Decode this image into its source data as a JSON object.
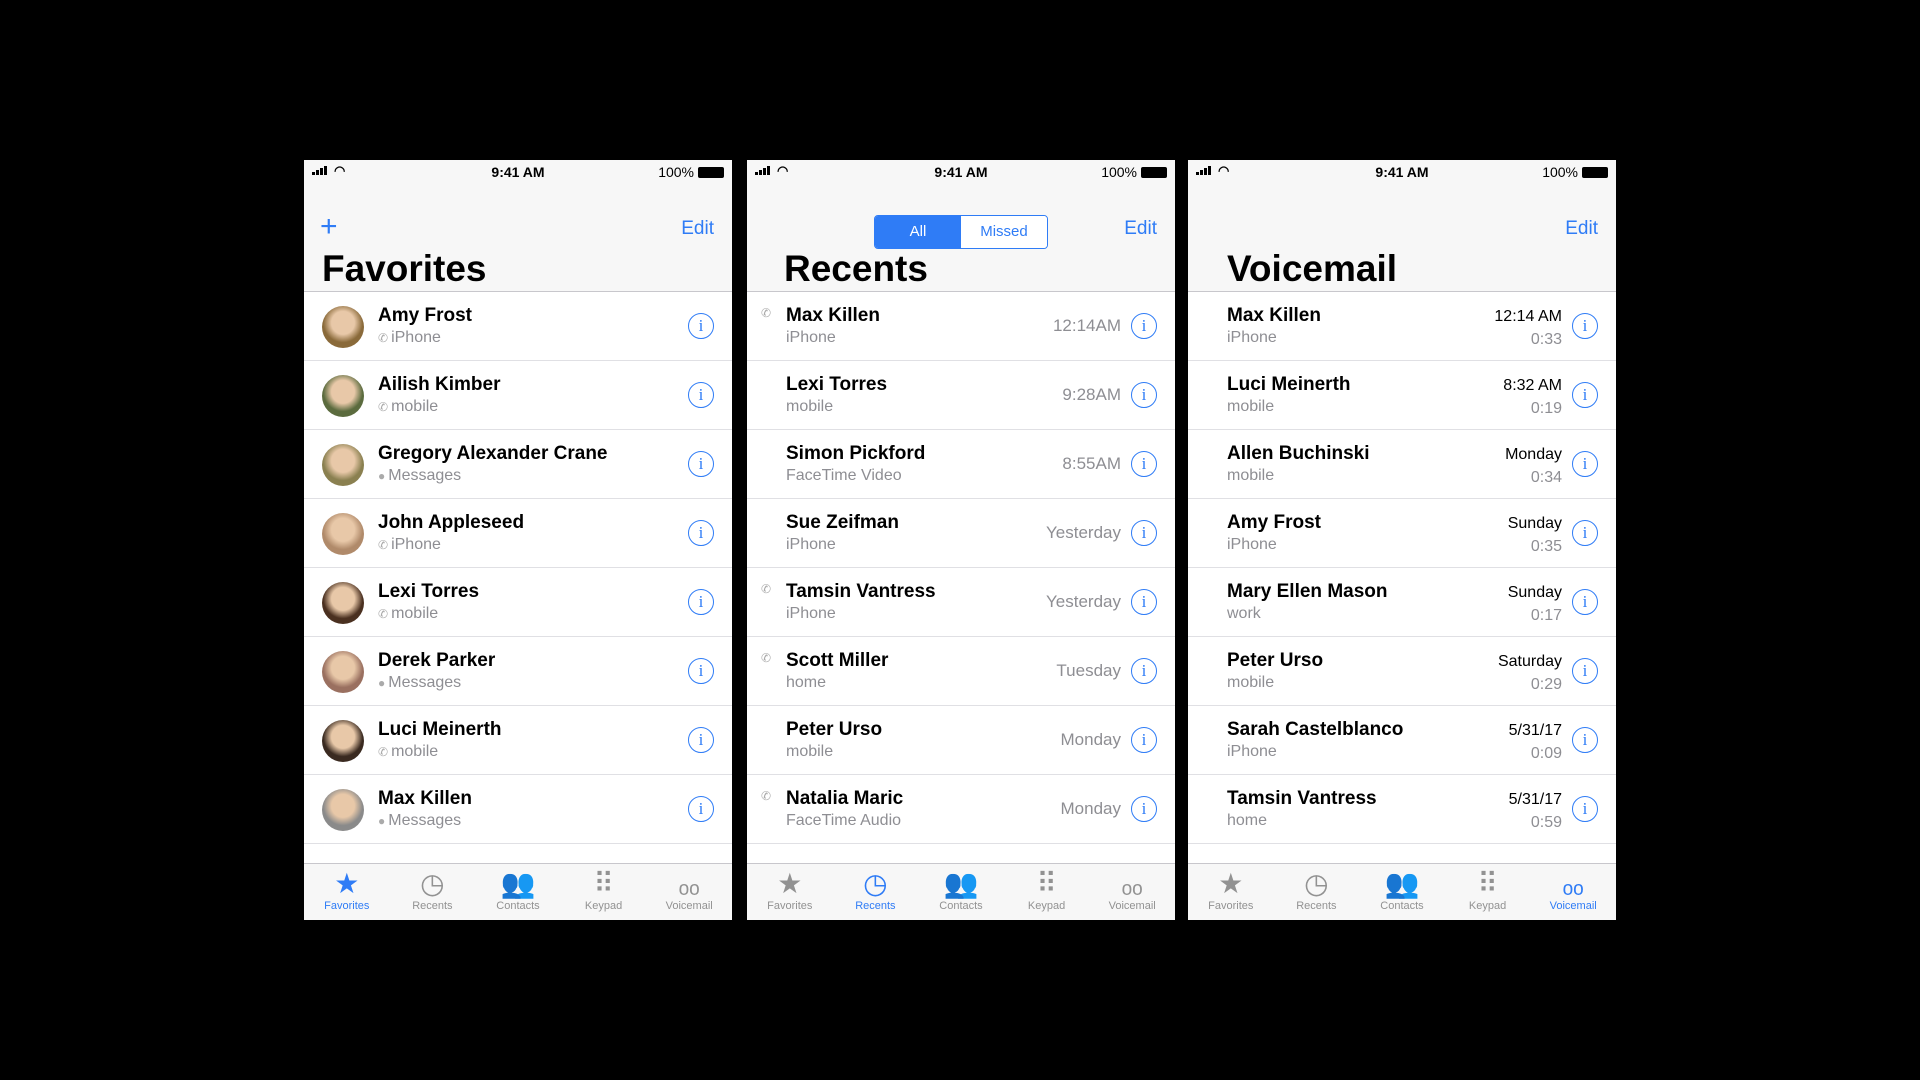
{
  "status": {
    "time": "9:41 AM",
    "battery": "100%"
  },
  "accent": "#2f7cf6",
  "tabbar": [
    {
      "label": "Favorites",
      "icon": "star-icon"
    },
    {
      "label": "Recents",
      "icon": "clock-icon"
    },
    {
      "label": "Contacts",
      "icon": "contacts-icon"
    },
    {
      "label": "Keypad",
      "icon": "keypad-icon"
    },
    {
      "label": "Voicemail",
      "icon": "voicemail-icon"
    }
  ],
  "favorites": {
    "title": "Favorites",
    "edit": "Edit",
    "add": "+",
    "items": [
      {
        "name": "Amy Frost",
        "sub": "iPhone",
        "kind": "phone",
        "color": "#8a6a3a"
      },
      {
        "name": "Ailish Kimber",
        "sub": "mobile",
        "kind": "phone",
        "color": "#5b6b3e"
      },
      {
        "name": "Gregory Alexander Crane",
        "sub": "Messages",
        "kind": "message",
        "color": "#8a8050"
      },
      {
        "name": "John Appleseed",
        "sub": "iPhone",
        "kind": "phone",
        "color": "#b08a6a"
      },
      {
        "name": "Lexi Torres",
        "sub": "mobile",
        "kind": "phone",
        "color": "#4a3020"
      },
      {
        "name": "Derek Parker",
        "sub": "Messages",
        "kind": "message",
        "color": "#9a7060"
      },
      {
        "name": "Luci Meinerth",
        "sub": "mobile",
        "kind": "phone",
        "color": "#3a2a20"
      },
      {
        "name": "Max Killen",
        "sub": "Messages",
        "kind": "message",
        "color": "#8a8a8a"
      }
    ]
  },
  "recents": {
    "title": "Recents",
    "edit": "Edit",
    "segments": [
      "All",
      "Missed"
    ],
    "items": [
      {
        "name": "Max Killen",
        "sub": "iPhone",
        "when": "12:14AM",
        "outgoing": true
      },
      {
        "name": "Lexi Torres",
        "sub": "mobile",
        "when": "9:28AM",
        "outgoing": false
      },
      {
        "name": "Simon Pickford",
        "sub": "FaceTime Video",
        "when": "8:55AM",
        "outgoing": false
      },
      {
        "name": "Sue Zeifman",
        "sub": "iPhone",
        "when": "Yesterday",
        "outgoing": false
      },
      {
        "name": "Tamsin Vantress",
        "sub": "iPhone",
        "when": "Yesterday",
        "outgoing": true
      },
      {
        "name": "Scott Miller",
        "sub": "home",
        "when": "Tuesday",
        "outgoing": true
      },
      {
        "name": "Peter Urso",
        "sub": "mobile",
        "when": "Monday",
        "outgoing": false
      },
      {
        "name": "Natalia Maric",
        "sub": "FaceTime Audio",
        "when": "Monday",
        "outgoing": true
      }
    ]
  },
  "voicemail": {
    "title": "Voicemail",
    "edit": "Edit",
    "items": [
      {
        "name": "Max Killen",
        "sub": "iPhone",
        "when": "12:14 AM",
        "dur": "0:33"
      },
      {
        "name": "Luci Meinerth",
        "sub": "mobile",
        "when": "8:32 AM",
        "dur": "0:19"
      },
      {
        "name": "Allen Buchinski",
        "sub": "mobile",
        "when": "Monday",
        "dur": "0:34"
      },
      {
        "name": "Amy Frost",
        "sub": "iPhone",
        "when": "Sunday",
        "dur": "0:35"
      },
      {
        "name": "Mary Ellen Mason",
        "sub": "work",
        "when": "Sunday",
        "dur": "0:17"
      },
      {
        "name": "Peter Urso",
        "sub": "mobile",
        "when": "Saturday",
        "dur": "0:29"
      },
      {
        "name": "Sarah Castelblanco",
        "sub": "iPhone",
        "when": "5/31/17",
        "dur": "0:09"
      },
      {
        "name": "Tamsin Vantress",
        "sub": "home",
        "when": "5/31/17",
        "dur": "0:59"
      }
    ]
  }
}
